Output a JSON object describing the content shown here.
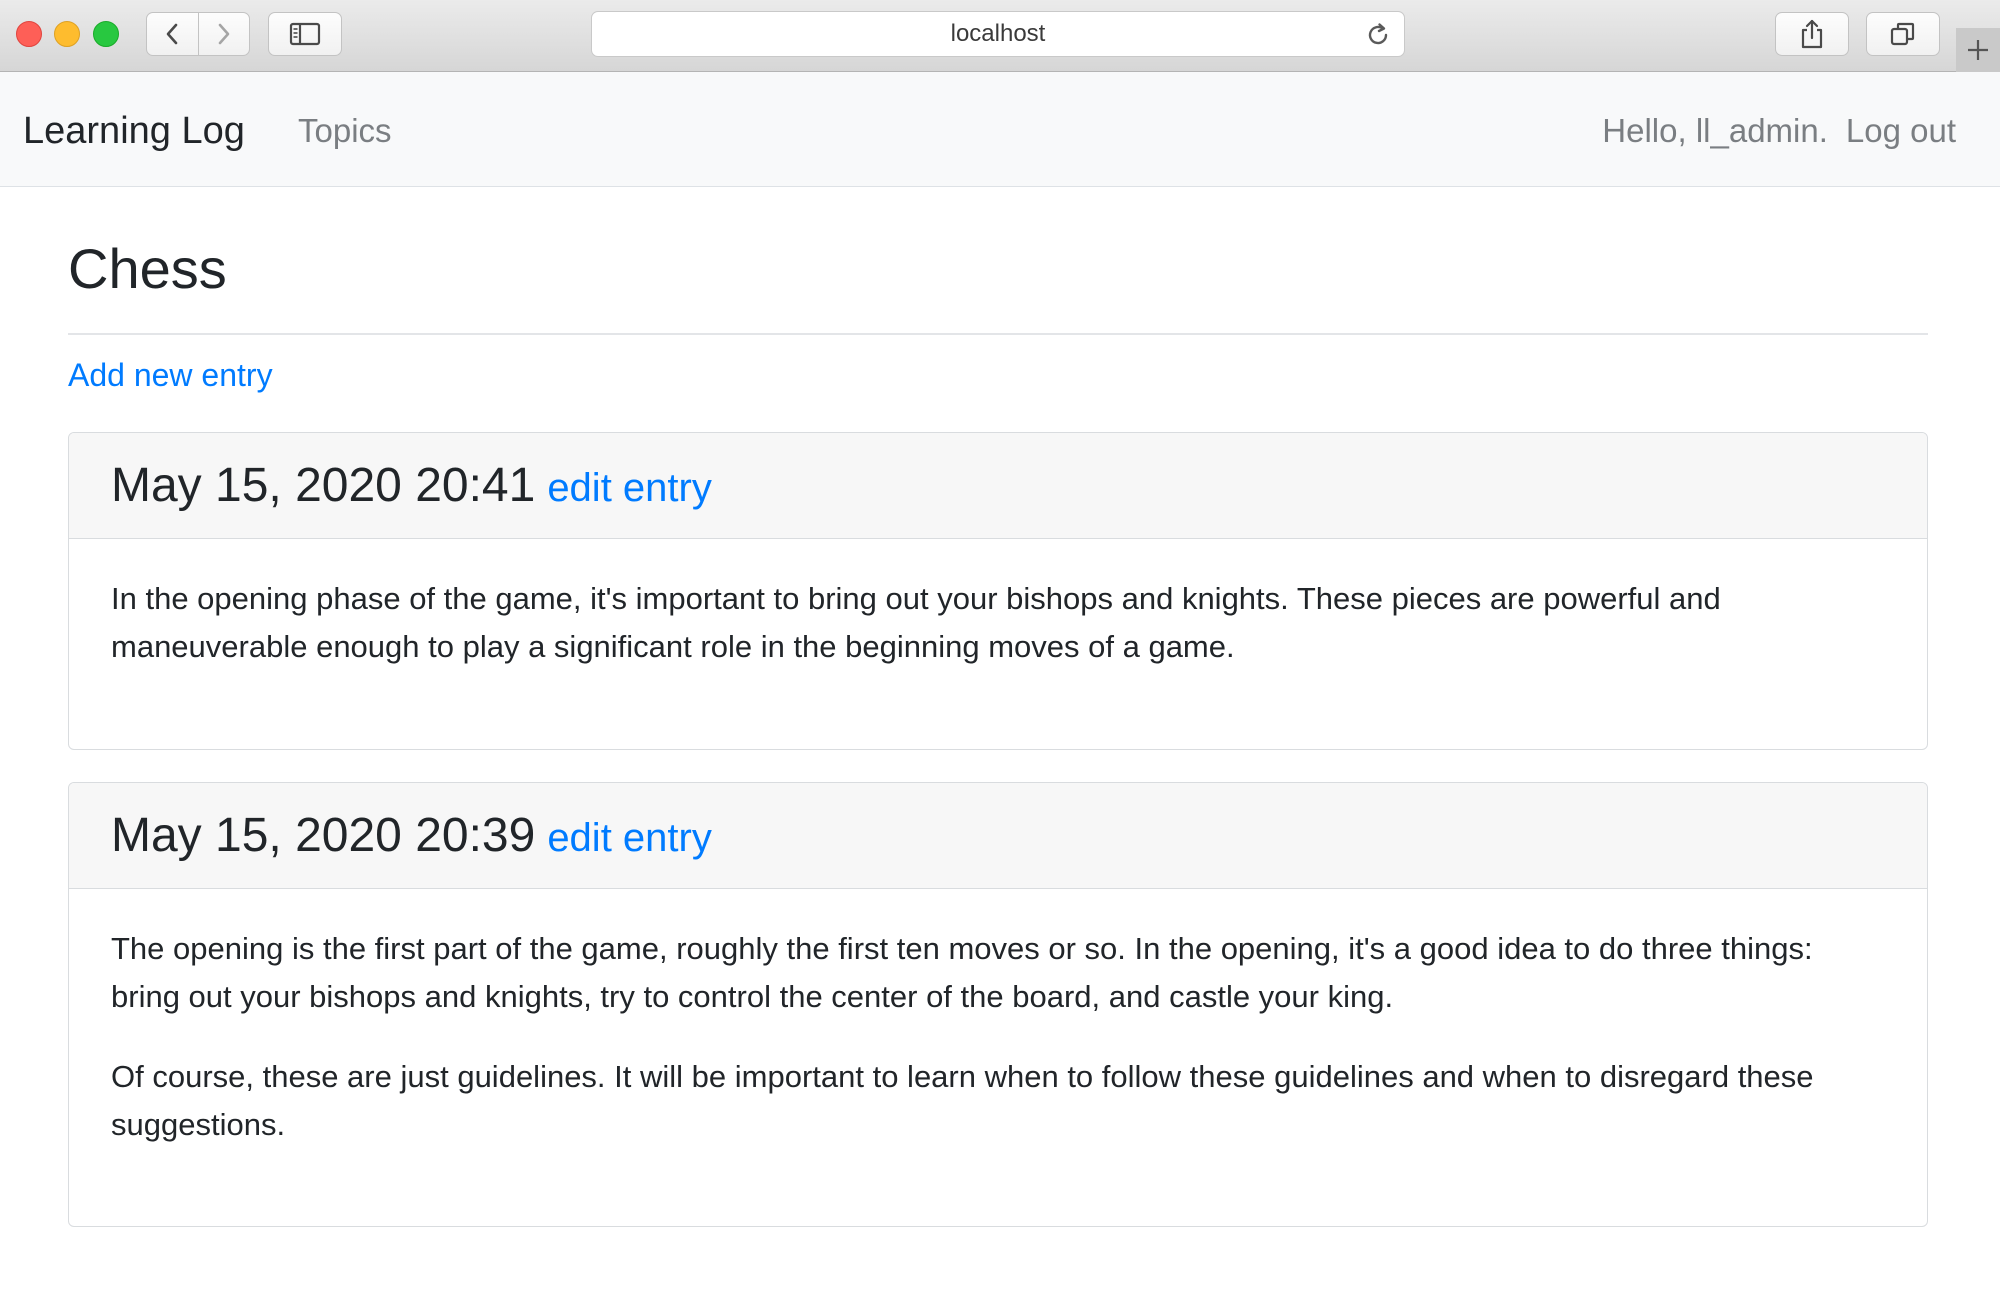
{
  "browser": {
    "address": "localhost",
    "icons": [
      "back-arrow-icon",
      "forward-arrow-icon",
      "sidebar-icon",
      "reload-icon",
      "share-icon",
      "tabs-icon",
      "plus-icon"
    ]
  },
  "navbar": {
    "brand": "Learning Log",
    "topics": "Topics",
    "greeting": "Hello, ll_admin.",
    "logout": "Log out"
  },
  "topic": {
    "title": "Chess",
    "add_entry": "Add new entry"
  },
  "entries": [
    {
      "date": "May 15, 2020 20:41",
      "edit": "edit entry",
      "paragraphs": [
        "In the opening phase of the game, it's important to bring out your bishops and knights. These pieces are powerful and maneuverable enough to play a significant role in the beginning moves of a game."
      ]
    },
    {
      "date": "May 15, 2020 20:39",
      "edit": "edit entry",
      "paragraphs": [
        "The opening is the first part of the game, roughly the first ten moves or so. In the opening, it's a good idea to do three things: bring out your bishops and knights, try to control the center of the board, and castle your king.",
        "Of course, these are just guidelines. It will be important to learn when to follow these guidelines and when to disregard these suggestions."
      ]
    }
  ],
  "colors": {
    "link": "#007bff",
    "navbar_bg": "#f8f9fa",
    "card_header_bg": "#f7f7f7"
  }
}
